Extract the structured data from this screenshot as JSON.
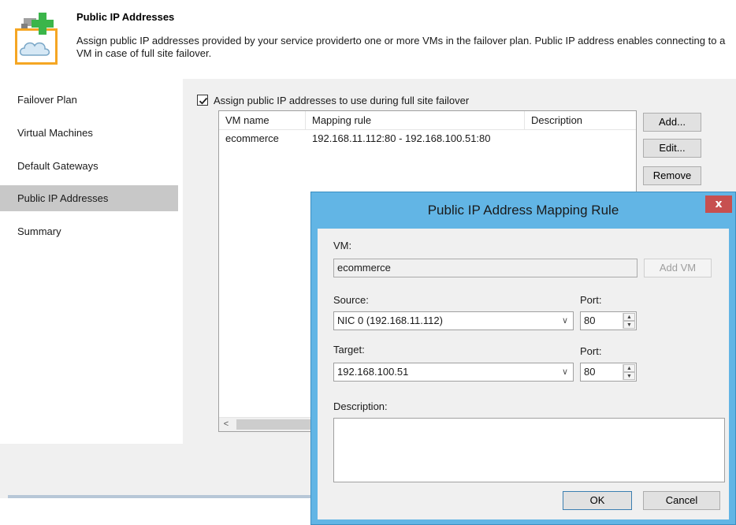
{
  "header": {
    "title": "Public IP Addresses",
    "description": "Assign public IP addresses provided by your service providerto one or more VMs in the failover plan. Public IP address enables connecting to a VM in case of full site failover."
  },
  "nav": {
    "items": [
      {
        "label": "Failover Plan",
        "selected": false
      },
      {
        "label": "Virtual Machines",
        "selected": false
      },
      {
        "label": "Default Gateways",
        "selected": false
      },
      {
        "label": "Public IP Addresses",
        "selected": true
      },
      {
        "label": "Summary",
        "selected": false
      }
    ]
  },
  "main": {
    "checkbox_label": "Assign public IP addresses to use during full site failover",
    "checkbox_checked": true,
    "table": {
      "columns": [
        "VM name",
        "Mapping rule",
        "Description"
      ],
      "rows": [
        {
          "vm_name": "ecommerce",
          "mapping_rule": "192.168.11.112:80 - 192.168.100.51:80",
          "description": ""
        }
      ]
    },
    "buttons": {
      "add": "Add...",
      "edit": "Edit...",
      "remove": "Remove"
    }
  },
  "dialog": {
    "title": "Public IP Address Mapping Rule",
    "close_glyph": "x",
    "vm_label": "VM:",
    "vm_value": "ecommerce",
    "add_vm_button": "Add VM",
    "source_label": "Source:",
    "source_value": "NIC 0 (192.168.11.112)",
    "source_port_label": "Port:",
    "source_port_value": "80",
    "target_label": "Target:",
    "target_value": "192.168.100.51",
    "target_port_label": "Port:",
    "target_port_value": "80",
    "description_label": "Description:",
    "description_value": "",
    "ok_button": "OK",
    "cancel_button": "Cancel"
  },
  "colors": {
    "dialog_frame": "#62b5e5",
    "close_button": "#c75050",
    "nav_selected": "#c8c8c8",
    "panel_background": "#f0f0f0"
  }
}
